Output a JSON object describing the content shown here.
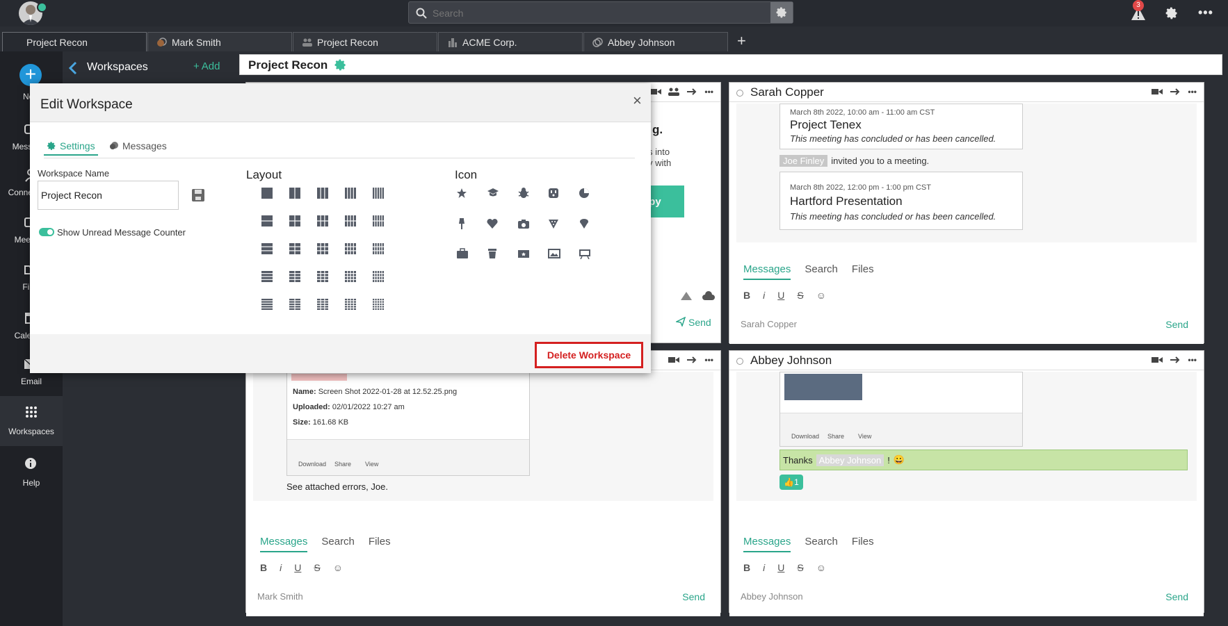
{
  "topbar": {
    "search_placeholder": "Search",
    "notification_count": "3"
  },
  "tabs": [
    {
      "label": "Project Recon"
    },
    {
      "label": "Mark Smith"
    },
    {
      "label": "Project Recon"
    },
    {
      "label": "ACME Corp."
    },
    {
      "label": "Abbey Johnson"
    }
  ],
  "rail": {
    "new": "New",
    "messages": "Messages",
    "connections": "Connections",
    "meetings": "Meetings",
    "files": "Files",
    "calendar": "Calendar",
    "email": "Email",
    "workspaces": "Workspaces",
    "help": "Help"
  },
  "wspanel": {
    "title": "Workspaces",
    "add": "Add"
  },
  "main": {
    "title": "Project Recon"
  },
  "panes": {
    "tl": {
      "partial_title": "g.",
      "partial_line1": "s into",
      "partial_line2": "y with",
      "copy_btn": "opy"
    },
    "tr": {
      "name": "Sarah Copper",
      "meetings": [
        {
          "date": "March 8th 2022, 10:00 am - 11:00 am CST",
          "title": "Project Tenex",
          "note": "This meeting has concluded or has been cancelled."
        },
        {
          "date": "March 8th 2022, 12:00 pm - 1:00 pm CST",
          "title": "Hartford Presentation",
          "note": "This meeting has concluded or has been cancelled."
        }
      ],
      "invite_name": "Joe Finley",
      "invite_text": "invited you to a meeting.",
      "placeholder": "Sarah Copper"
    },
    "bl": {
      "file_name_label": "Name:",
      "file_name": "Screen Shot 2022-01-28 at 12.52.25.png",
      "uploaded_label": "Uploaded:",
      "uploaded": "02/01/2022 10:27 am",
      "size_label": "Size:",
      "size": "161.68 KB",
      "download": "Download",
      "share": "Share",
      "view": "View",
      "message": "See attached errors, Joe.",
      "placeholder": "Mark Smith"
    },
    "br": {
      "name": "Abbey Johnson",
      "download": "Download",
      "share": "Share",
      "view": "View",
      "thanks": "Thanks",
      "mention": "Abbey Johnson",
      "exclaim": "!",
      "emoji": "😀",
      "reaction": "👍1",
      "placeholder": "Abbey Johnson"
    }
  },
  "pane_tabs": {
    "messages": "Messages",
    "search": "Search",
    "files": "Files",
    "send": "Send"
  },
  "modal": {
    "title": "Edit Workspace",
    "tab_settings": "Settings",
    "tab_messages": "Messages",
    "name_label": "Workspace Name",
    "name_value": "Project Recon",
    "toggle_label": "Show Unread Message Counter",
    "layout_title": "Layout",
    "icon_title": "Icon",
    "delete": "Delete Workspace",
    "close": "×"
  },
  "colors": {
    "accent": "#2aa58a",
    "danger": "#d42020",
    "bg_dark": "#2b2e34",
    "rail": "#1f2126",
    "new_button": "#2196d9"
  }
}
